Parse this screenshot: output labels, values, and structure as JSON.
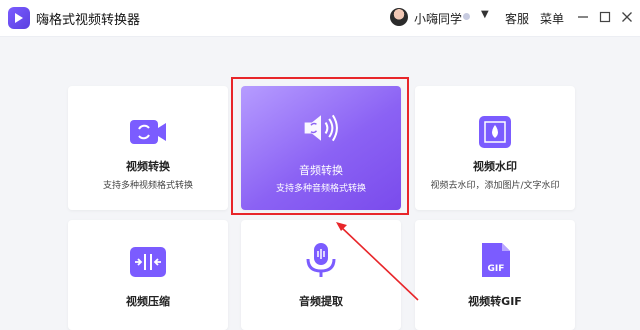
{
  "app": {
    "title": "嗨格式视频转换器"
  },
  "header": {
    "username": "小嗨同学",
    "menu": [
      "客服",
      "菜单"
    ]
  },
  "cards": [
    {
      "title": "视频转换",
      "desc": "支持多种视频格式转换",
      "icon": "video-convert-icon"
    },
    {
      "title": "音频转换",
      "desc": "支持多种音频格式转换",
      "icon": "audio-convert-icon",
      "selected": true
    },
    {
      "title": "视频水印",
      "desc": "视频去水印，添加图片/文字水印",
      "icon": "video-watermark-icon"
    },
    {
      "title": "视频压缩",
      "desc": "",
      "icon": "video-compress-icon"
    },
    {
      "title": "音频提取",
      "desc": "",
      "icon": "audio-extract-icon"
    },
    {
      "title": "视频转GIF",
      "desc": "",
      "icon": "gif-icon"
    }
  ],
  "colors": {
    "accent": "#7b5cff",
    "highlight": "#e8262a"
  }
}
